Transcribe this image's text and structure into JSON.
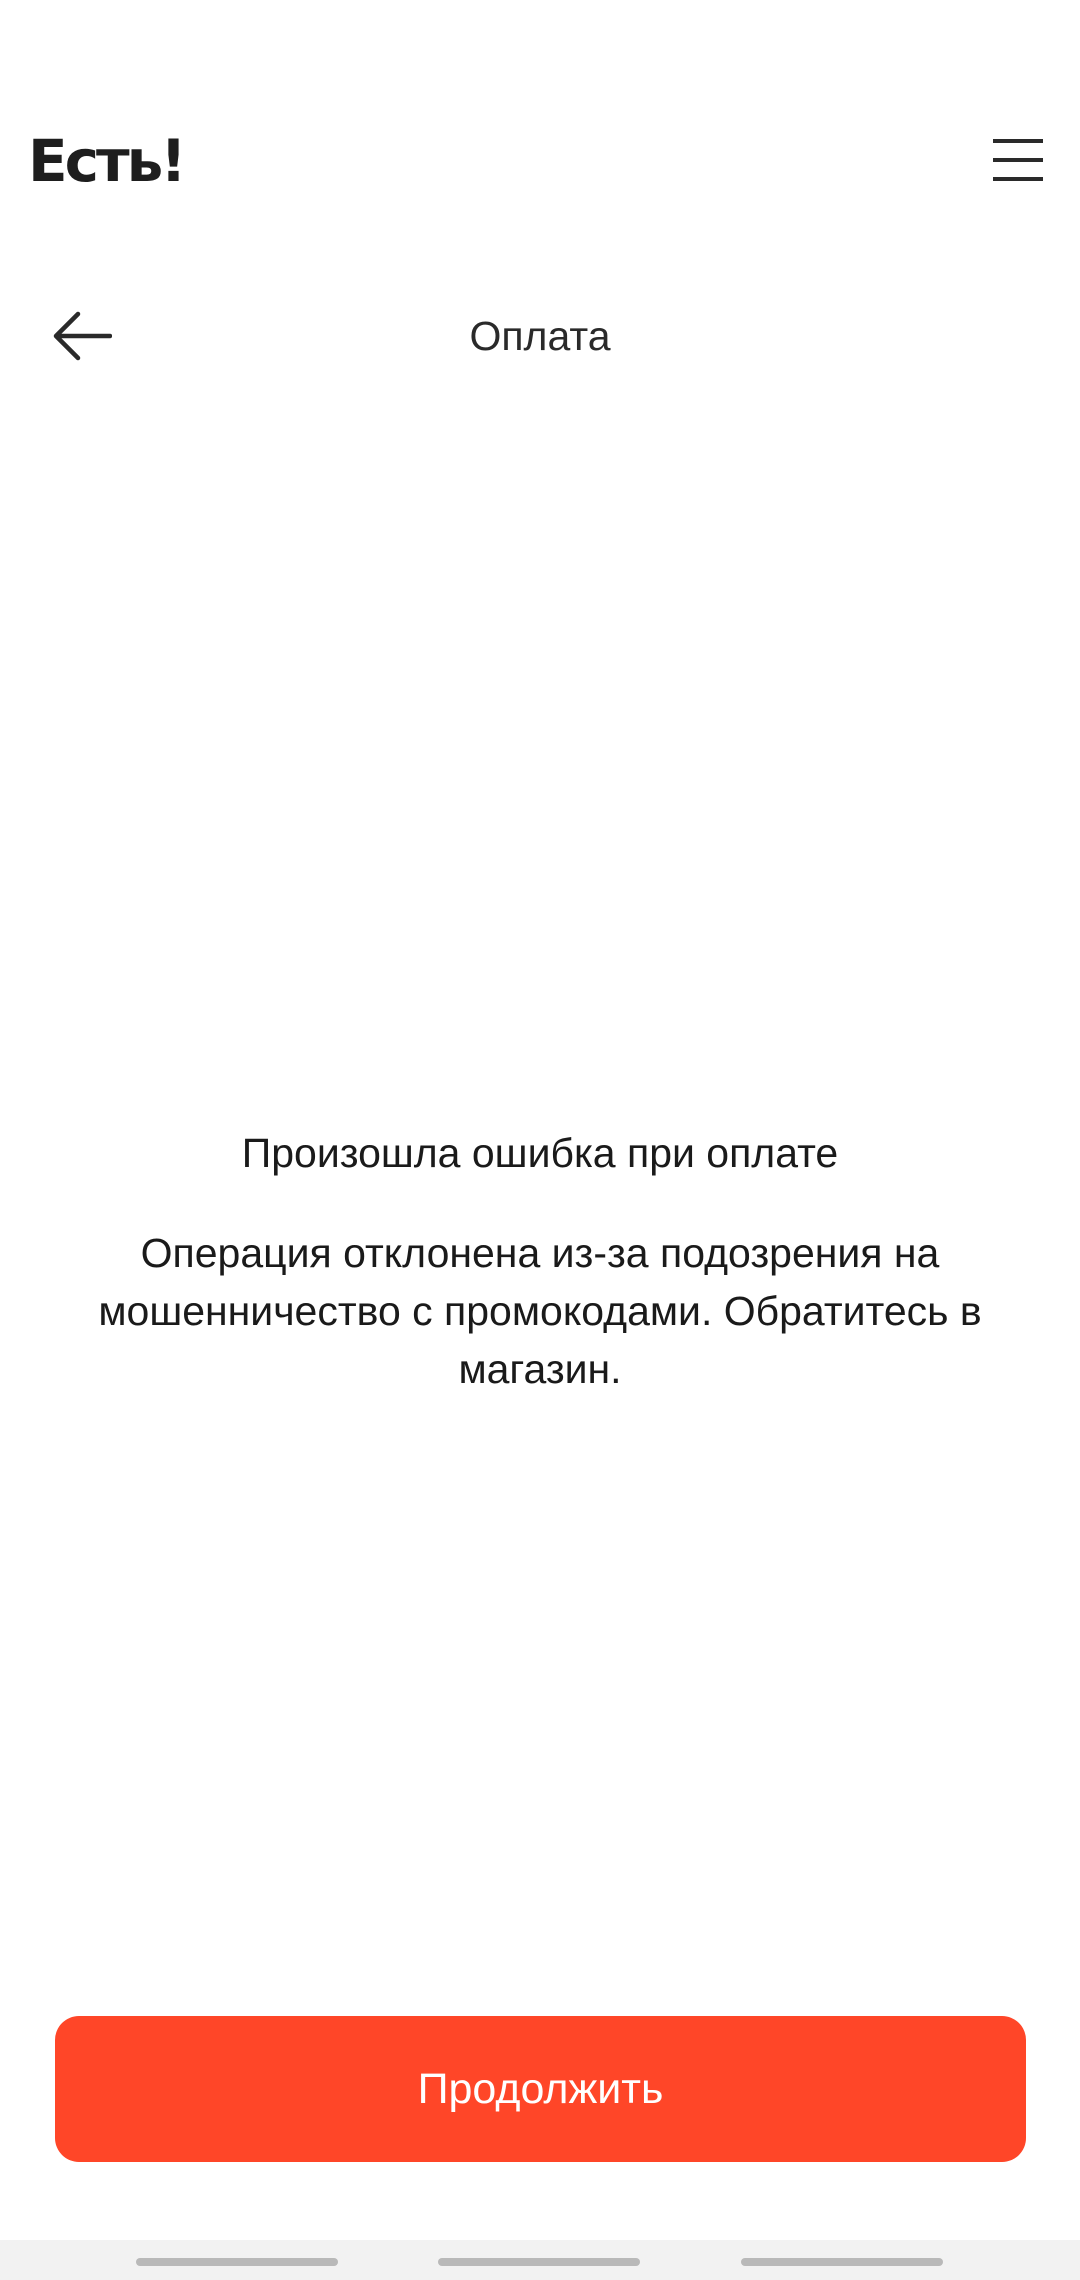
{
  "header": {
    "logo_text": "Есть!",
    "menu_icon": "hamburger-menu-icon"
  },
  "toolbar": {
    "back_icon": "arrow-left-icon",
    "title": "Оплата"
  },
  "error": {
    "title": "Произошла ошибка при оплате",
    "message": "Операция отклонена из-за подозрения на мошенничество с промокодами. Обратитесь в магазин."
  },
  "actions": {
    "continue_label": "Продолжить"
  },
  "colors": {
    "accent": "#ff4628",
    "text": "#1a1a1a",
    "background": "#ffffff"
  }
}
